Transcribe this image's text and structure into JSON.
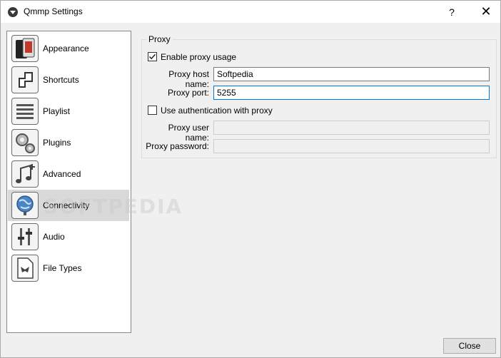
{
  "window": {
    "title": "Qmmp Settings",
    "help_glyph": "?",
    "close_glyph": "✕"
  },
  "sidebar": {
    "items": [
      {
        "label": "Appearance",
        "icon": "appearance-icon"
      },
      {
        "label": "Shortcuts",
        "icon": "shortcuts-icon"
      },
      {
        "label": "Playlist",
        "icon": "playlist-icon"
      },
      {
        "label": "Plugins",
        "icon": "plugins-icon"
      },
      {
        "label": "Advanced",
        "icon": "advanced-icon"
      },
      {
        "label": "Connectivity",
        "icon": "connectivity-icon",
        "selected": true
      },
      {
        "label": "Audio",
        "icon": "audio-icon"
      },
      {
        "label": "File Types",
        "icon": "file-types-icon"
      }
    ]
  },
  "proxy": {
    "group_title": "Proxy",
    "enable_label": "Enable proxy usage",
    "enable_checked": true,
    "host_label": "Proxy host name:",
    "host_value": "Softpedia",
    "port_label": "Proxy port:",
    "port_value": "5255",
    "auth_label": "Use authentication with proxy",
    "auth_checked": false,
    "user_label": "Proxy user name:",
    "user_value": "",
    "password_label": "Proxy password:",
    "password_value": ""
  },
  "footer": {
    "close_label": "Close"
  },
  "watermark": "SOFTPEDIA",
  "colors": {
    "selection": "#d9d9d9",
    "focus_border": "#0078d7",
    "window_bg": "#f0f0f0"
  }
}
